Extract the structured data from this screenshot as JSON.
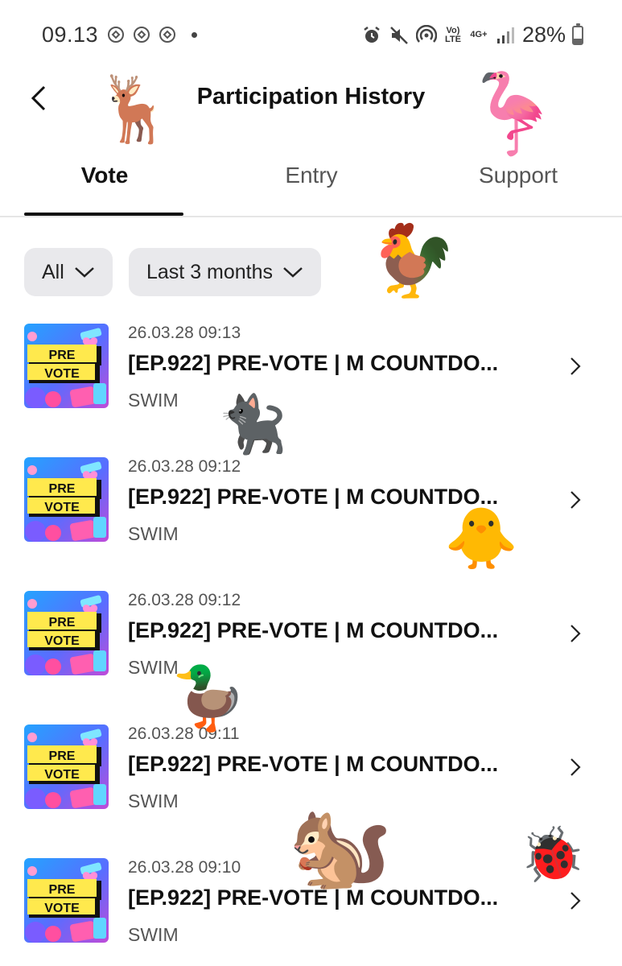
{
  "status_bar": {
    "time": "09.13",
    "battery_percent": "28%",
    "network_label_top": "Vo) LTE",
    "network_label_4g": "4G+",
    "battery_level": 0.28
  },
  "header": {
    "title": "Participation History"
  },
  "tabs": [
    {
      "label": "Vote",
      "active": true
    },
    {
      "label": "Entry",
      "active": false
    },
    {
      "label": "Support",
      "active": false
    }
  ],
  "filters": {
    "type": "All",
    "period": "Last 3 months"
  },
  "items": [
    {
      "date": "26.03.28 09:13",
      "title": "[EP.922] PRE-VOTE | M COUNTDO...",
      "artist": "SWIM",
      "thumb_line1": "PRE",
      "thumb_line2": "VOTE"
    },
    {
      "date": "26.03.28 09:12",
      "title": "[EP.922] PRE-VOTE | M COUNTDO...",
      "artist": "SWIM",
      "thumb_line1": "PRE",
      "thumb_line2": "VOTE"
    },
    {
      "date": "26.03.28 09:12",
      "title": "[EP.922] PRE-VOTE | M COUNTDO...",
      "artist": "SWIM",
      "thumb_line1": "PRE",
      "thumb_line2": "VOTE"
    },
    {
      "date": "26.03.28 09:11",
      "title": "[EP.922] PRE-VOTE | M COUNTDO...",
      "artist": "SWIM",
      "thumb_line1": "PRE",
      "thumb_line2": "VOTE"
    },
    {
      "date": "26.03.28 09:10",
      "title": "[EP.922] PRE-VOTE | M COUNTDO...",
      "artist": "SWIM",
      "thumb_line1": "PRE",
      "thumb_line2": "VOTE"
    }
  ],
  "stickers": {
    "deer": "🦌",
    "flamingo": "🦩",
    "rooster": "🐓",
    "cat": "🐈‍⬛",
    "chick": "🐥",
    "duck": "🦆",
    "chipmunk": "🐿️",
    "ladybug": "🐞"
  },
  "colors": {
    "accent": "#111111",
    "filter_bg": "#e9e9ec",
    "thumb_bg": "#1f8fff",
    "thumb_label_bg": "#ffe94d"
  }
}
